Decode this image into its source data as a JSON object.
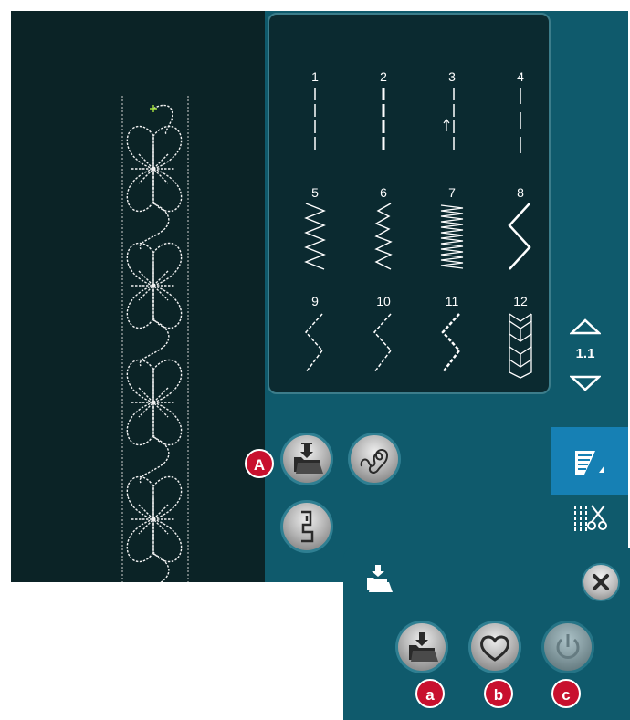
{
  "stitches": [
    {
      "number": "1",
      "icon": "straight-stitch-icon"
    },
    {
      "number": "2",
      "icon": "triple-straight-stitch-icon"
    },
    {
      "number": "3",
      "icon": "straight-stitch-left-needle-icon"
    },
    {
      "number": "4",
      "icon": "basting-stitch-icon"
    },
    {
      "number": "5",
      "icon": "zigzag-stitch-icon"
    },
    {
      "number": "6",
      "icon": "zigzag-narrow-stitch-icon"
    },
    {
      "number": "7",
      "icon": "satin-stitch-icon"
    },
    {
      "number": "8",
      "icon": "wide-zigzag-stitch-icon"
    },
    {
      "number": "9",
      "icon": "three-step-zigzag-icon"
    },
    {
      "number": "10",
      "icon": "three-step-zigzag-icon"
    },
    {
      "number": "11",
      "icon": "three-step-zigzag-bold-icon"
    },
    {
      "number": "12",
      "icon": "honeycomb-stitch-icon"
    }
  ],
  "scroll": {
    "page": "1.1"
  },
  "callouts": {
    "A": "A",
    "a": "a",
    "b": "b",
    "c": "c"
  },
  "colors": {
    "panel": "#0b2a30",
    "frame": "#0f5a6c",
    "active_tab": "#1680b4",
    "callout": "#c8102e"
  }
}
